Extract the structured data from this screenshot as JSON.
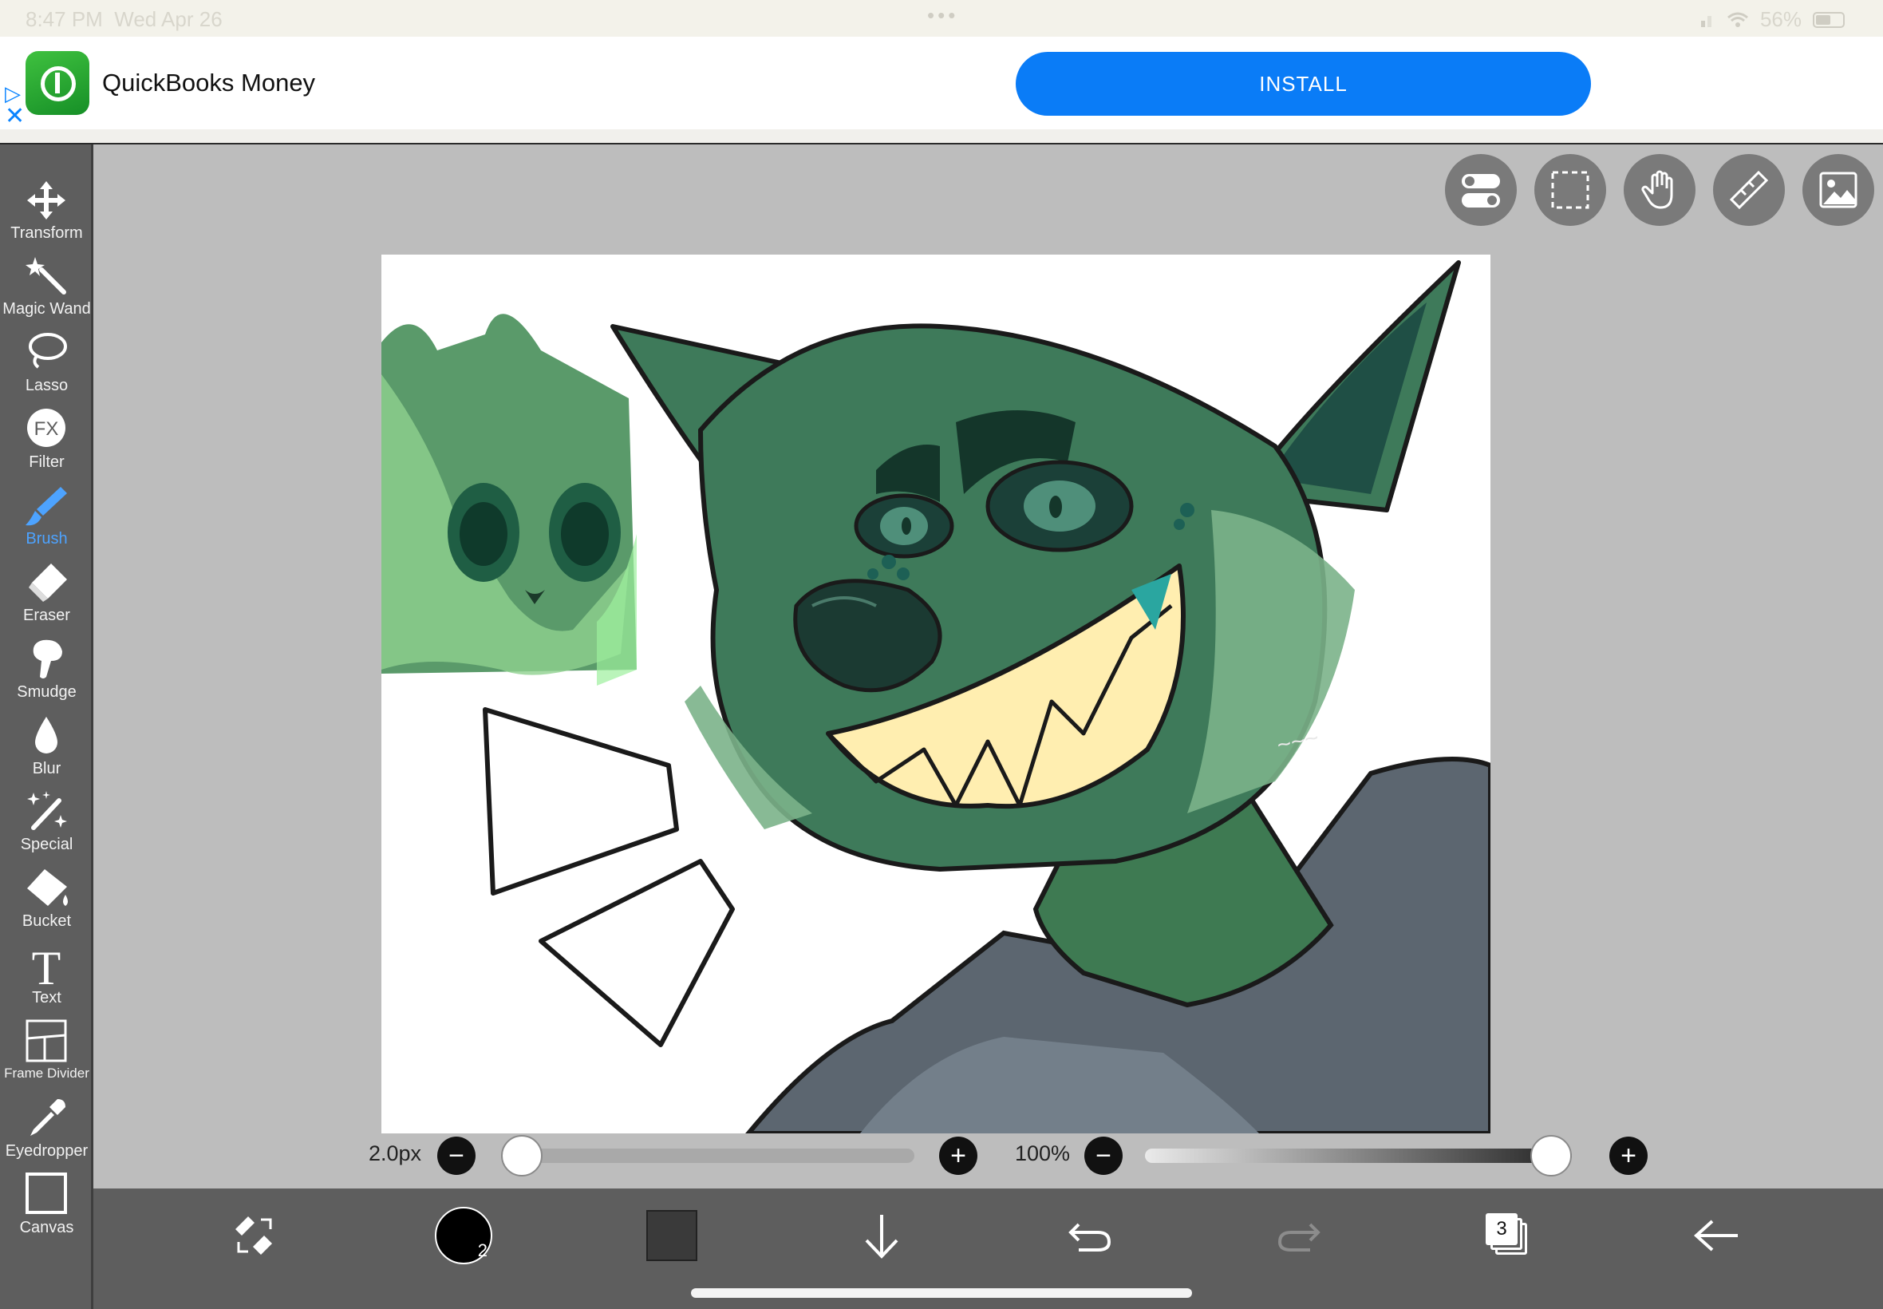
{
  "status_bar": {
    "time": "8:47 PM",
    "date": "Wed Apr 26",
    "dots": "•••",
    "battery": "56%"
  },
  "ad": {
    "app_name": "QuickBooks Money",
    "install_label": "INSTALL",
    "choice_icon": "ad-choices-icon",
    "close_icon": "close-icon",
    "accent": "#0a7cf7"
  },
  "tools": [
    {
      "label": "Transform",
      "icon": "move-arrows-icon"
    },
    {
      "label": "Magic Wand",
      "icon": "magic-wand-icon"
    },
    {
      "label": "Lasso",
      "icon": "lasso-icon"
    },
    {
      "label": "Filter",
      "icon": "fx-icon",
      "icon_text": "FX"
    },
    {
      "label": "Brush",
      "icon": "brush-icon",
      "active": true
    },
    {
      "label": "Eraser",
      "icon": "eraser-icon"
    },
    {
      "label": "Smudge",
      "icon": "smudge-icon"
    },
    {
      "label": "Blur",
      "icon": "drop-icon"
    },
    {
      "label": "Special",
      "icon": "sparkle-pen-icon"
    },
    {
      "label": "Bucket",
      "icon": "bucket-icon"
    },
    {
      "label": "Text",
      "icon": "text-icon",
      "icon_text": "T"
    },
    {
      "label": "Frame Divider",
      "icon": "frame-divider-icon"
    },
    {
      "label": "Eyedropper",
      "icon": "eyedropper-icon"
    },
    {
      "label": "Canvas",
      "icon": "canvas-icon"
    }
  ],
  "top_buttons": [
    "toggles-icon",
    "selection-icon",
    "hand-icon",
    "ruler-icon",
    "image-icon"
  ],
  "brush_size": {
    "label": "2.0px",
    "value_fraction": 0.0
  },
  "opacity": {
    "label": "100%",
    "value_fraction": 1.0
  },
  "bottom_bar": {
    "brush_badge": "2",
    "layer_count": "3",
    "color_swatch": "#3a3a3a",
    "primary_color": "#000000"
  },
  "colors": {
    "accent": "#4da3ff",
    "toolbar_bg": "#5e5e5e",
    "workspace_bg": "#bdbdbd"
  }
}
